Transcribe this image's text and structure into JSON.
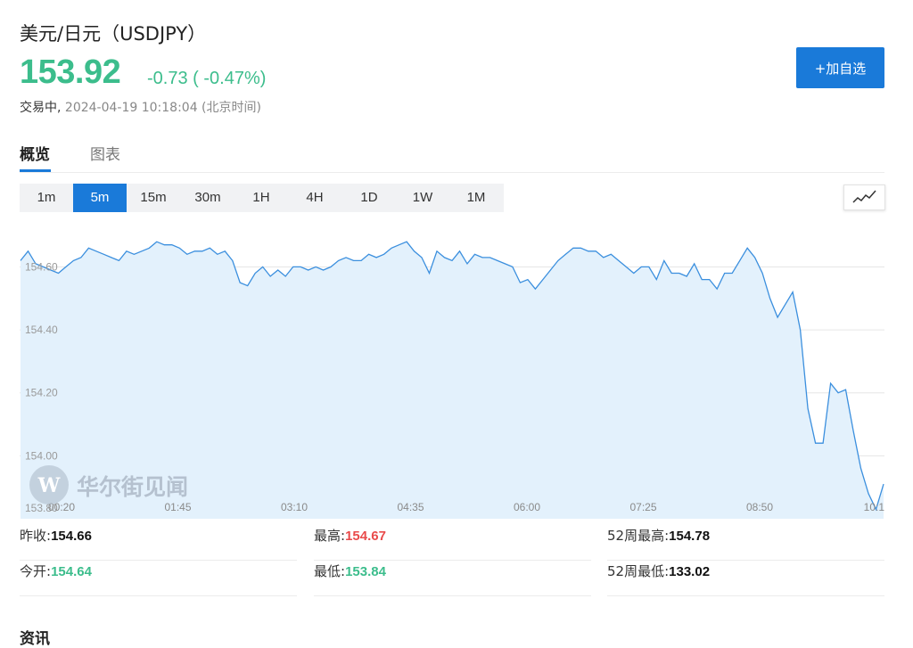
{
  "header": {
    "title": "美元/日元（USDJPY）",
    "price": "153.92",
    "change": "-0.73 ( -0.47%)",
    "status": "交易中,",
    "timestamp": "2024-04-19 10:18:04 (北京时间)",
    "add_button": "+加自选"
  },
  "tabs": [
    {
      "label": "概览",
      "active": true
    },
    {
      "label": "图表",
      "active": false
    }
  ],
  "periods": [
    {
      "label": "1m",
      "active": false
    },
    {
      "label": "5m",
      "active": true
    },
    {
      "label": "15m",
      "active": false
    },
    {
      "label": "30m",
      "active": false
    },
    {
      "label": "1H",
      "active": false
    },
    {
      "label": "4H",
      "active": false
    },
    {
      "label": "1D",
      "active": false
    },
    {
      "label": "1W",
      "active": false
    },
    {
      "label": "1M",
      "active": false
    }
  ],
  "chart_type_icon": "line-chart-icon",
  "watermark": "华尔街见闻",
  "stats": {
    "prev_close": {
      "label": "昨收:",
      "value": "154.66"
    },
    "high": {
      "label": "最高:",
      "value": "154.67"
    },
    "week52_high": {
      "label": "52周最高:",
      "value": "154.78"
    },
    "open": {
      "label": "今开:",
      "value": "154.64"
    },
    "low": {
      "label": "最低:",
      "value": "153.84"
    },
    "week52_low": {
      "label": "52周最低:",
      "value": "133.02"
    }
  },
  "bottom_text": "资讯",
  "colors": {
    "accent": "#1a7ad9",
    "down": "#3cbd8c",
    "up": "#e94b4b",
    "line": "#3b8fde",
    "fill": "#e3f1fc"
  },
  "chart_data": {
    "type": "area",
    "y_tick_labels": [
      "153.80",
      "154.00",
      "154.20",
      "154.40",
      "154.60"
    ],
    "x_tick_labels": [
      "00:20",
      "01:45",
      "03:10",
      "04:35",
      "06:00",
      "07:25",
      "08:50",
      "10:1"
    ],
    "ylim": [
      153.8,
      154.74
    ],
    "grid": "horizontal",
    "series": [
      {
        "x": [
          0,
          0.09,
          0.18,
          0.27,
          0.36,
          0.45,
          0.54,
          0.63,
          0.72,
          0.81,
          0.9,
          0.99,
          1.08,
          1.17,
          1.26,
          1.35,
          1.44,
          1.53,
          1.62,
          1.71,
          1.8,
          1.89,
          1.98,
          2.07,
          2.16,
          2.25,
          2.34,
          2.43,
          2.52,
          2.61,
          2.7,
          2.79,
          2.88,
          2.97,
          3.06,
          3.15,
          3.24,
          3.33,
          3.42,
          3.51,
          3.6,
          3.69,
          3.78,
          3.87,
          3.96,
          4.05,
          4.14,
          4.23,
          4.32,
          4.41,
          4.5,
          4.59,
          4.68,
          4.77,
          4.86,
          4.95,
          5.04,
          5.13,
          5.22,
          5.31,
          5.4,
          5.49,
          5.58,
          5.67,
          5.76,
          5.85,
          5.94,
          6.03,
          6.12,
          6.21,
          6.3,
          6.39,
          6.48,
          6.57,
          6.66,
          6.75,
          6.84,
          6.93,
          7.02,
          7.11,
          7.2,
          7.29,
          7.38,
          7.47,
          7.56,
          7.65,
          7.74,
          7.83,
          7.92,
          8.01,
          8.1,
          8.19,
          8.28,
          8.37,
          8.46,
          8.55,
          8.64,
          8.73,
          8.82,
          8.91,
          9,
          9.09,
          9.18,
          9.27,
          9.36,
          9.45,
          9.54,
          9.63,
          9.72,
          9.81,
          9.9,
          9.99,
          10.08,
          10.17,
          10.26
        ],
        "y": [
          154.62,
          154.65,
          154.61,
          154.6,
          154.59,
          154.58,
          154.6,
          154.62,
          154.63,
          154.66,
          154.65,
          154.64,
          154.63,
          154.62,
          154.65,
          154.64,
          154.65,
          154.66,
          154.68,
          154.67,
          154.67,
          154.66,
          154.64,
          154.65,
          154.65,
          154.66,
          154.64,
          154.65,
          154.62,
          154.55,
          154.54,
          154.58,
          154.6,
          154.57,
          154.59,
          154.57,
          154.6,
          154.6,
          154.59,
          154.6,
          154.59,
          154.6,
          154.62,
          154.63,
          154.62,
          154.62,
          154.64,
          154.63,
          154.64,
          154.66,
          154.67,
          154.68,
          154.65,
          154.63,
          154.58,
          154.65,
          154.63,
          154.62,
          154.65,
          154.61,
          154.64,
          154.63,
          154.63,
          154.62,
          154.61,
          154.6,
          154.55,
          154.56,
          154.53,
          154.56,
          154.59,
          154.62,
          154.64,
          154.66,
          154.66,
          154.65,
          154.65,
          154.63,
          154.64,
          154.62,
          154.6,
          154.58,
          154.6,
          154.6,
          154.56,
          154.62,
          154.58,
          154.58,
          154.57,
          154.61,
          154.56,
          154.56,
          154.53,
          154.58,
          154.58,
          154.62,
          154.66,
          154.63,
          154.58,
          154.5,
          154.44,
          154.48,
          154.52,
          154.4,
          154.15,
          154.04,
          154.04,
          154.23,
          154.2,
          154.21,
          154.08,
          153.96,
          153.88,
          153.83,
          153.91
        ]
      }
    ]
  }
}
